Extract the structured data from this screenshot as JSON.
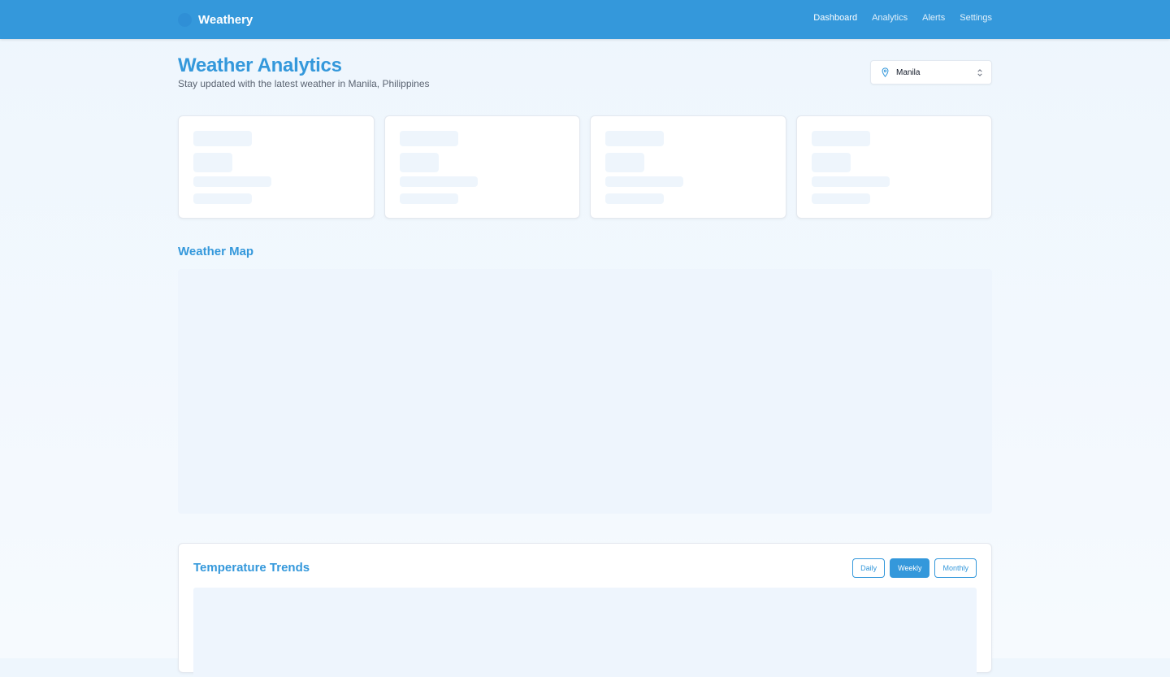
{
  "app": {
    "name": "Weathery",
    "icon": "globe-icon"
  },
  "nav": {
    "items": [
      {
        "label": "Dashboard",
        "active": true
      },
      {
        "label": "Analytics",
        "active": false
      },
      {
        "label": "Alerts",
        "active": false
      },
      {
        "label": "Settings",
        "active": false
      }
    ]
  },
  "header": {
    "title": "Weather Analytics",
    "subtitle": "Stay updated with the latest weather in Manila, Philippines"
  },
  "location_select": {
    "value": "Manila",
    "icon": "map-pin-icon",
    "chevron_icon": "chevron-updown-icon"
  },
  "stat_cards": {
    "count": 4,
    "state": "loading"
  },
  "map": {
    "title": "Weather Map"
  },
  "trends": {
    "title": "Temperature Trends",
    "ranges": [
      {
        "label": "Daily",
        "active": false
      },
      {
        "label": "Weekly",
        "active": true
      },
      {
        "label": "Monthly",
        "active": false
      }
    ]
  },
  "colors": {
    "primary": "#3498db",
    "background": "#eef6fd",
    "skeleton": "#eef5fc",
    "card_border": "#e3e8ef"
  }
}
